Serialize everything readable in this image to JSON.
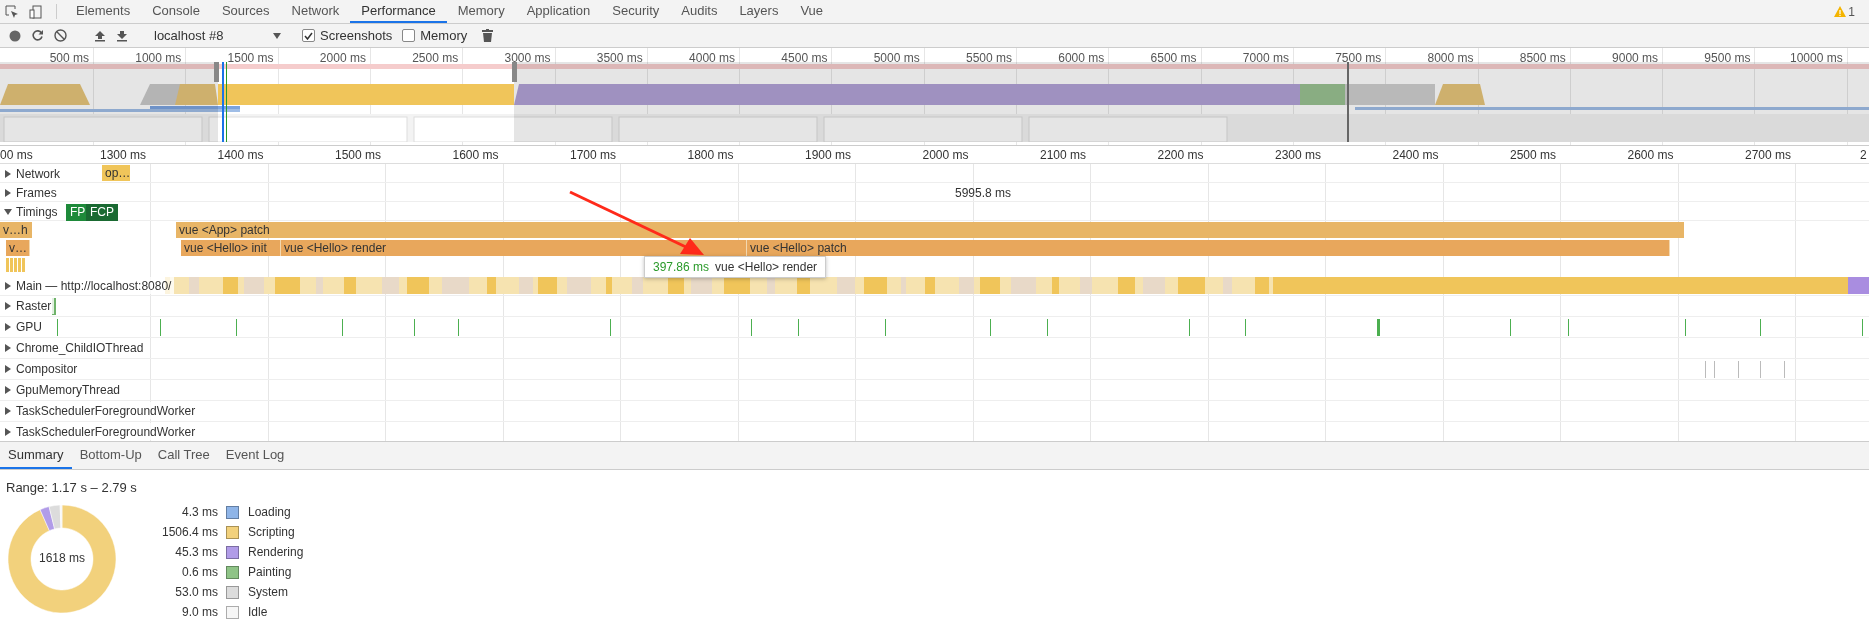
{
  "tabs": [
    {
      "label": "Elements",
      "selected": false
    },
    {
      "label": "Console",
      "selected": false
    },
    {
      "label": "Sources",
      "selected": false
    },
    {
      "label": "Network",
      "selected": false
    },
    {
      "label": "Performance",
      "selected": true
    },
    {
      "label": "Memory",
      "selected": false
    },
    {
      "label": "Application",
      "selected": false
    },
    {
      "label": "Security",
      "selected": false
    },
    {
      "label": "Audits",
      "selected": false
    },
    {
      "label": "Layers",
      "selected": false
    },
    {
      "label": "Vue",
      "selected": false
    }
  ],
  "warning_count": "1",
  "toolbar": {
    "profile": "localhost #8",
    "options": [
      {
        "label": "Screenshots",
        "checked": true
      },
      {
        "label": "Memory",
        "checked": false
      }
    ]
  },
  "overview": {
    "ticks": [
      "500 ms",
      "1000 ms",
      "1500 ms",
      "2000 ms",
      "2500 ms",
      "3000 ms",
      "3500 ms",
      "4000 ms",
      "4500 ms",
      "5000 ms",
      "5500 ms",
      "6000 ms",
      "6500 ms",
      "7000 ms",
      "7500 ms",
      "8000 ms",
      "8500 ms",
      "9000 ms",
      "9500 ms",
      "10000 ms"
    ]
  },
  "timeline": {
    "ticks": [
      "00 ms",
      "1300 ms",
      "1400 ms",
      "1500 ms",
      "1600 ms",
      "1700 ms",
      "1800 ms",
      "1900 ms",
      "2000 ms",
      "2100 ms",
      "2200 ms",
      "2300 ms",
      "2400 ms",
      "2500 ms",
      "2600 ms",
      "2700 ms",
      "2"
    ],
    "network_item": "op…",
    "frame_duration": "5995.8 ms",
    "markers": [
      {
        "label": "FP"
      },
      {
        "label": "FCP"
      }
    ],
    "timing_rows": [
      [
        {
          "label": "v…h"
        },
        {
          "label": "vue <App> patch"
        }
      ],
      [
        {
          "label": "v…"
        },
        {
          "label": "vue <Hello> init"
        },
        {
          "label": "vue <Hello> render"
        },
        {
          "label": "vue <Hello> patch"
        }
      ]
    ],
    "tracks": [
      {
        "label": "Network",
        "expanded": false
      },
      {
        "label": "Frames",
        "expanded": false
      },
      {
        "label": "Timings",
        "expanded": true
      },
      {
        "label": "Main — http://localhost:8080/",
        "expanded": false
      },
      {
        "label": "Raster",
        "expanded": false
      },
      {
        "label": "GPU",
        "expanded": false
      },
      {
        "label": "Chrome_ChildIOThread",
        "expanded": false
      },
      {
        "label": "Compositor",
        "expanded": false
      },
      {
        "label": "GpuMemoryThread",
        "expanded": false
      },
      {
        "label": "TaskSchedulerForegroundWorker",
        "expanded": false
      },
      {
        "label": "TaskSchedulerForegroundWorker",
        "expanded": false
      }
    ],
    "tooltip": {
      "duration": "397.86 ms",
      "name": "vue <Hello> render"
    }
  },
  "details_tabs": [
    {
      "label": "Summary",
      "selected": true
    },
    {
      "label": "Bottom-Up",
      "selected": false
    },
    {
      "label": "Call Tree",
      "selected": false
    },
    {
      "label": "Event Log",
      "selected": false
    }
  ],
  "summary": {
    "range": "Range: 1.17 s – 2.79 s",
    "total": "1618 ms",
    "legend": [
      {
        "value": "4.3 ms",
        "color": "#8fb5e8"
      },
      {
        "value": "1506.4 ms",
        "color": "#f2d17c"
      },
      {
        "value": "45.3 ms",
        "color": "#b19ce8"
      },
      {
        "value": "0.6 ms",
        "color": "#8fc487"
      },
      {
        "value": "53.0 ms",
        "color": "#dcdcdc"
      },
      {
        "value": "9.0 ms",
        "color": "#f6f6f6"
      }
    ],
    "chart_data": {
      "type": "donut",
      "categories": [
        "Loading",
        "Scripting",
        "Rendering",
        "Painting",
        "System",
        "Idle"
      ],
      "values": [
        null,
        93.06,
        2.8,
        null,
        3.27,
        0.56
      ]
    }
  }
}
